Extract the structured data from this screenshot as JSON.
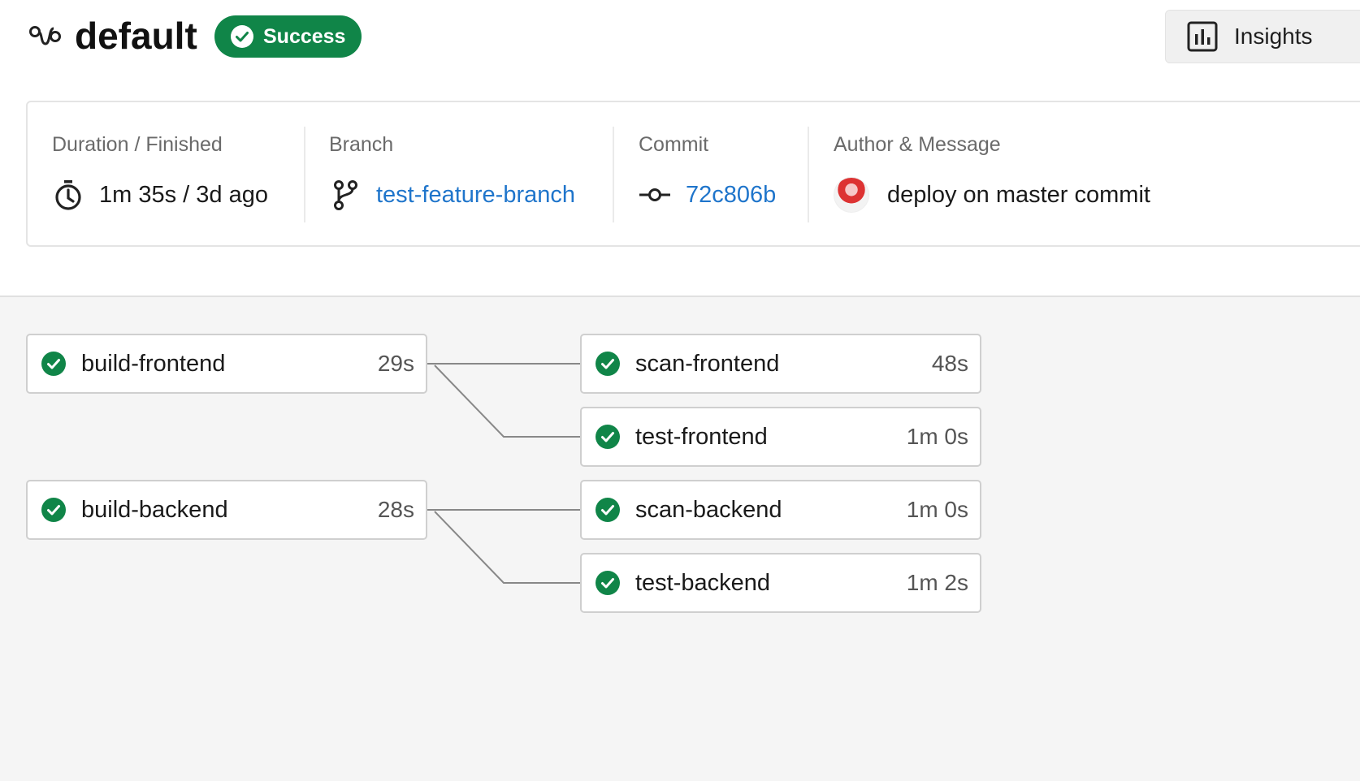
{
  "header": {
    "title": "default",
    "status": "Success",
    "insights_label": "Insights"
  },
  "info": {
    "duration": {
      "label": "Duration / Finished",
      "value": "1m 35s / 3d ago"
    },
    "branch": {
      "label": "Branch",
      "value": "test-feature-branch"
    },
    "commit": {
      "label": "Commit",
      "value": "72c806b"
    },
    "author": {
      "label": "Author & Message",
      "message": "deploy on master commit"
    }
  },
  "pipeline": {
    "jobs": [
      {
        "name": "build-frontend",
        "duration": "29s",
        "status": "success"
      },
      {
        "name": "build-backend",
        "duration": "28s",
        "status": "success"
      },
      {
        "name": "scan-frontend",
        "duration": "48s",
        "status": "success"
      },
      {
        "name": "test-frontend",
        "duration": "1m 0s",
        "status": "success"
      },
      {
        "name": "scan-backend",
        "duration": "1m 0s",
        "status": "success"
      },
      {
        "name": "test-backend",
        "duration": "1m 2s",
        "status": "success"
      }
    ]
  },
  "colors": {
    "success": "#108548",
    "link": "#1f75cb"
  },
  "icons": {
    "pipeline": "pipeline-icon",
    "status": "check-circle-icon",
    "duration": "timer-icon",
    "branch": "branch-icon",
    "commit": "commit-icon",
    "insights": "chart-icon"
  }
}
